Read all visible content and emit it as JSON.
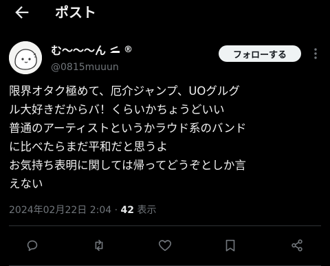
{
  "header": {
    "title": "ポスト"
  },
  "author": {
    "display_name": "む〜〜〜ん",
    "badge_mark": "®",
    "handle": "@0815muuun"
  },
  "follow_button": {
    "label": "フォローする"
  },
  "tweet": {
    "lines": [
      "限界オタク極めて、厄介ジャンプ、UOグルグ",
      "ル大好きだからバ！くらいかちょうどいい",
      "普通のアーティストというかラウド系のバンド",
      "に比べたらまだ平和だと思うよ",
      "お気持ち表明に関しては帰ってどうぞとしか言",
      "えない"
    ]
  },
  "meta": {
    "timestamp": "2024年02月22日 2:04",
    "separator": "·",
    "views_count": "42",
    "views_label": "表示"
  },
  "actions": [
    "reply-icon",
    "repost-icon",
    "like-icon",
    "bookmark-icon",
    "share-icon"
  ],
  "colors": {
    "background": "#000000",
    "text": "#e7e9ea",
    "secondary": "#71767b",
    "follow_bg": "#eff3f4",
    "divider": "#2f3336"
  }
}
